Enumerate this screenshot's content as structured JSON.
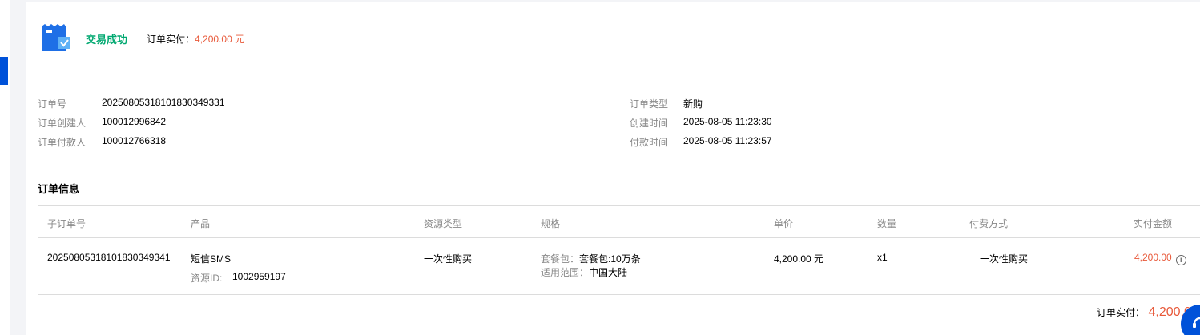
{
  "status": {
    "text": "交易成功",
    "paid_label": "订单实付：",
    "paid_value": "4,200.00 元"
  },
  "info_left": [
    {
      "label": "订单号",
      "value": "20250805318101830349331"
    },
    {
      "label": "订单创建人",
      "value": "100012996842"
    },
    {
      "label": "订单付款人",
      "value": "100012766318"
    }
  ],
  "info_right": [
    {
      "label": "订单类型",
      "value": "新购"
    },
    {
      "label": "创建时间",
      "value": "2025-08-05 11:23:30"
    },
    {
      "label": "付款时间",
      "value": "2025-08-05 11:23:57"
    }
  ],
  "section_title": "订单信息",
  "table": {
    "headers": [
      "子订单号",
      "产品",
      "资源类型",
      "规格",
      "单价",
      "数量",
      "付费方式",
      "实付金额"
    ],
    "row": {
      "sub_order_id": "20250805318101830349341",
      "product": "短信SMS",
      "resource_id_label": "资源ID:",
      "resource_id": "1002959197",
      "resource_type": "一次性购买",
      "spec_package_label": "套餐包：",
      "spec_package_value": "套餐包:10万条",
      "spec_scope_label": "适用范围：",
      "spec_scope_value": "中国大陆",
      "unit_price": "4,200.00 元",
      "quantity": "x1",
      "billing_mode": "一次性购买",
      "paid_amount": "4,200.00"
    }
  },
  "total": {
    "label": "订单实付：",
    "value": "4,200.0"
  },
  "icons": {
    "status": "receipt-check-icon",
    "info": "info-circle-icon",
    "float": "support-chat-icon"
  },
  "colors": {
    "success": "#00a870",
    "accent": "#e8593a",
    "brand": "#0052d9"
  }
}
